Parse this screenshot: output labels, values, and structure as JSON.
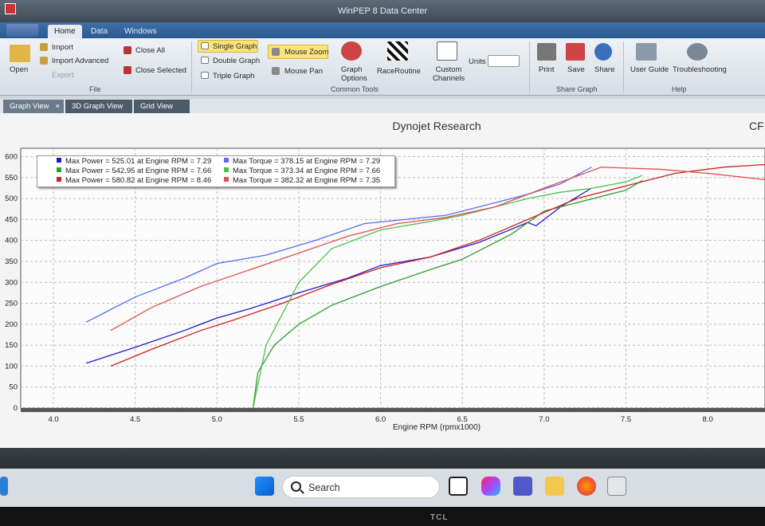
{
  "window": {
    "title": "WinPEP 8 Data Center"
  },
  "menu_tabs": [
    "Home",
    "Data",
    "Windows"
  ],
  "ribbon": {
    "file": {
      "open": "Open",
      "import": "Import",
      "import_advanced": "Import Advanced",
      "export": "Export",
      "close_all": "Close All",
      "close_selected": "Close Selected",
      "group": "File"
    },
    "tools": {
      "single_graph": "Single Graph",
      "double_graph": "Double Graph",
      "triple_graph": "Triple Graph",
      "mouse_zoom": "Mouse Zoom",
      "mouse_pan": "Mouse Pan",
      "graph_options": "Graph Options",
      "race_routine": "RaceRoutine",
      "custom_channels": "Custom Channels",
      "units": "Units",
      "group": "Common Tools"
    },
    "share": {
      "print": "Print",
      "save": "Save",
      "share": "Share",
      "group": "Share Graph"
    },
    "help": {
      "user_guide": "User Guide",
      "troubleshooting": "Troubleshooting",
      "group": "Help"
    }
  },
  "view_tabs": [
    "Graph View",
    "3D Graph View",
    "Grid View"
  ],
  "chart_title": "Dynojet Research",
  "cf_label": "CF:",
  "legend": [
    {
      "text": "Max Power = 525.01 at Engine RPM = 7.29",
      "color": "#1c1cc8"
    },
    {
      "text": "Max Power = 542.95 at Engine RPM = 7.66",
      "color": "#2e9e2e"
    },
    {
      "text": "Max Power = 580.82 at Engine RPM = 8.46",
      "color": "#d02020"
    },
    {
      "text": "Max Torque = 378.15 at Engine RPM = 7.29",
      "color": "#5a6cf0"
    },
    {
      "text": "Max Torque = 373.34 at Engine RPM = 7.66",
      "color": "#4cc04c"
    },
    {
      "text": "Max Torque = 382.32 at Engine RPM = 7.35",
      "color": "#e05050"
    }
  ],
  "taskbar": {
    "search_placeholder": "Search"
  },
  "monitor_brand": "TCL",
  "chart_data": {
    "type": "line",
    "title": "Dynojet Research",
    "xlabel": "Engine RPM (rpmx1000)",
    "ylabel": "",
    "xlim": [
      3.8,
      8.35
    ],
    "ylim": [
      0,
      620
    ],
    "xticks": [
      4.0,
      4.5,
      5.0,
      5.5,
      6.0,
      6.5,
      7.0,
      7.5,
      8.0
    ],
    "yticks": [
      0,
      50,
      100,
      150,
      200,
      250,
      300,
      350,
      400,
      450,
      500,
      550,
      600
    ],
    "grid": true,
    "legend_position": "top-left",
    "series": [
      {
        "color": "#1c1cc8",
        "x": [
          4.2,
          4.5,
          4.8,
          5.0,
          5.2,
          5.5,
          5.8,
          6.0,
          6.3,
          6.6,
          6.9,
          6.95,
          7.1,
          7.29
        ],
        "y": [
          107,
          145,
          185,
          215,
          237,
          275,
          310,
          340,
          360,
          395,
          443,
          435,
          480,
          525
        ]
      },
      {
        "color": "#2e9e2e",
        "x": [
          5.22,
          5.25,
          5.35,
          5.5,
          5.7,
          6.0,
          6.3,
          6.5,
          6.8,
          7.0,
          7.2,
          7.4,
          7.5,
          7.6
        ],
        "y": [
          0,
          85,
          150,
          200,
          245,
          290,
          330,
          355,
          415,
          470,
          490,
          510,
          520,
          543
        ]
      },
      {
        "color": "#d02020",
        "x": [
          4.35,
          4.6,
          4.9,
          5.1,
          5.4,
          5.7,
          6.0,
          6.3,
          6.6,
          6.9,
          7.2,
          7.5,
          7.8,
          8.1,
          8.35
        ],
        "y": [
          100,
          140,
          185,
          210,
          250,
          295,
          335,
          360,
          400,
          450,
          500,
          530,
          560,
          575,
          581
        ]
      },
      {
        "color": "#5a6cf0",
        "x": [
          4.2,
          4.5,
          4.8,
          5.0,
          5.3,
          5.6,
          5.9,
          6.1,
          6.4,
          6.7,
          6.9,
          7.1,
          7.29
        ],
        "y": [
          205,
          265,
          310,
          345,
          365,
          400,
          440,
          448,
          460,
          490,
          510,
          535,
          575
        ]
      },
      {
        "color": "#4cc04c",
        "x": [
          5.22,
          5.3,
          5.5,
          5.7,
          6.0,
          6.3,
          6.5,
          6.7,
          6.9,
          7.1,
          7.3,
          7.5,
          7.6
        ],
        "y": [
          0,
          150,
          300,
          380,
          425,
          445,
          460,
          480,
          500,
          515,
          525,
          540,
          555
        ]
      },
      {
        "color": "#e05050",
        "x": [
          4.35,
          4.6,
          4.9,
          5.2,
          5.5,
          5.8,
          6.1,
          6.4,
          6.7,
          7.0,
          7.35,
          7.7,
          8.0,
          8.35
        ],
        "y": [
          185,
          240,
          290,
          330,
          370,
          410,
          440,
          455,
          480,
          525,
          575,
          570,
          560,
          545
        ]
      }
    ]
  }
}
